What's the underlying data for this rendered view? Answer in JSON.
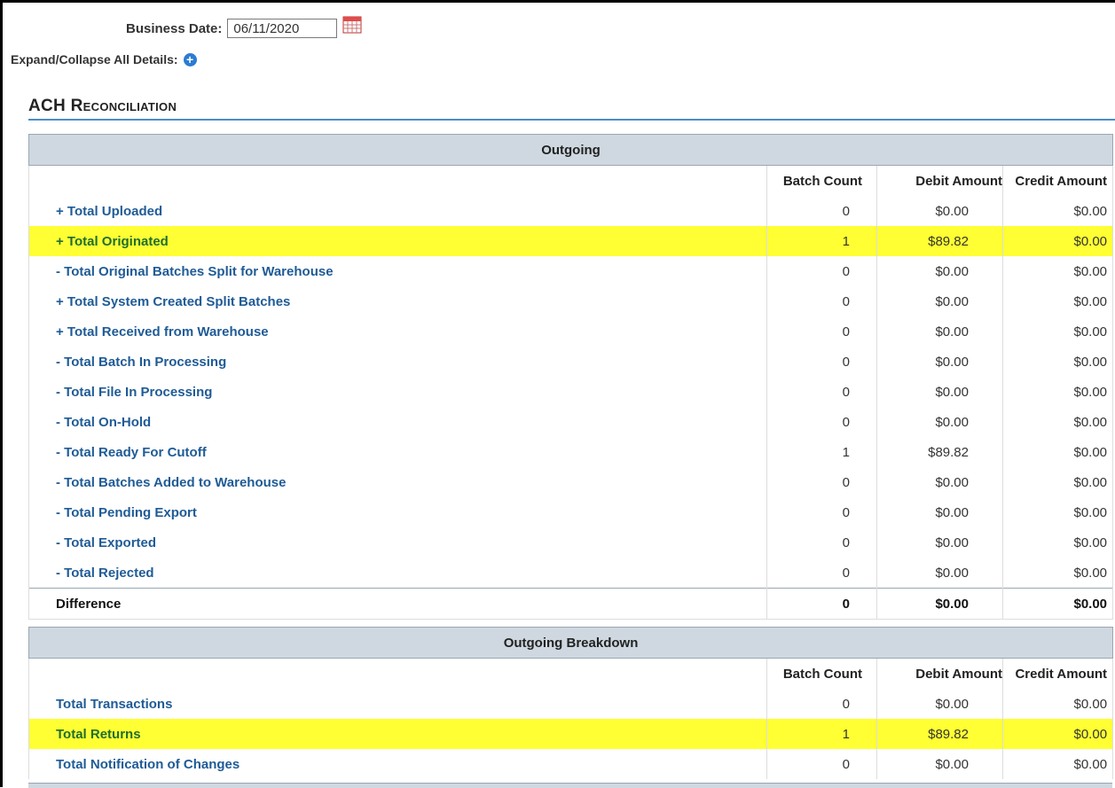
{
  "header": {
    "business_date_label": "Business Date:",
    "business_date_value": "06/11/2020",
    "expand_label": "Expand/Collapse All Details:"
  },
  "section_title": "ACH Reconciliation",
  "outgoing": {
    "title": "Outgoing",
    "columns": [
      "Batch Count",
      "Debit Amount",
      "Credit Amount"
    ],
    "rows": [
      {
        "label": "+ Total Uploaded",
        "batch": "0",
        "debit": "$0.00",
        "credit": "$0.00",
        "highlight": false
      },
      {
        "label": "+ Total Originated",
        "batch": "1",
        "debit": "$89.82",
        "credit": "$0.00",
        "highlight": true
      },
      {
        "label": "- Total Original Batches Split for Warehouse",
        "batch": "0",
        "debit": "$0.00",
        "credit": "$0.00",
        "highlight": false
      },
      {
        "label": "+ Total System Created Split Batches",
        "batch": "0",
        "debit": "$0.00",
        "credit": "$0.00",
        "highlight": false
      },
      {
        "label": "+ Total Received from Warehouse",
        "batch": "0",
        "debit": "$0.00",
        "credit": "$0.00",
        "highlight": false
      },
      {
        "label": "- Total Batch In Processing",
        "batch": "0",
        "debit": "$0.00",
        "credit": "$0.00",
        "highlight": false
      },
      {
        "label": "- Total File In Processing",
        "batch": "0",
        "debit": "$0.00",
        "credit": "$0.00",
        "highlight": false
      },
      {
        "label": "- Total On-Hold",
        "batch": "0",
        "debit": "$0.00",
        "credit": "$0.00",
        "highlight": false
      },
      {
        "label": "- Total Ready For Cutoff",
        "batch": "1",
        "debit": "$89.82",
        "credit": "$0.00",
        "highlight": false
      },
      {
        "label": "- Total Batches Added to Warehouse",
        "batch": "0",
        "debit": "$0.00",
        "credit": "$0.00",
        "highlight": false
      },
      {
        "label": "- Total Pending Export",
        "batch": "0",
        "debit": "$0.00",
        "credit": "$0.00",
        "highlight": false
      },
      {
        "label": "- Total Exported",
        "batch": "0",
        "debit": "$0.00",
        "credit": "$0.00",
        "highlight": false
      },
      {
        "label": "- Total Rejected",
        "batch": "0",
        "debit": "$0.00",
        "credit": "$0.00",
        "highlight": false
      }
    ],
    "difference": {
      "label": "Difference",
      "batch": "0",
      "debit": "$0.00",
      "credit": "$0.00"
    }
  },
  "breakdown": {
    "title": "Outgoing Breakdown",
    "columns": [
      "Batch Count",
      "Debit Amount",
      "Credit Amount"
    ],
    "rows": [
      {
        "label": "Total Transactions",
        "batch": "0",
        "debit": "$0.00",
        "credit": "$0.00",
        "highlight": false
      },
      {
        "label": "Total Returns",
        "batch": "1",
        "debit": "$89.82",
        "credit": "$0.00",
        "highlight": true
      },
      {
        "label": "Total Notification of Changes",
        "batch": "0",
        "debit": "$0.00",
        "credit": "$0.00",
        "highlight": false
      }
    ]
  },
  "colors": {
    "link": "#1f5b96",
    "highlight": "#ffff33",
    "header_bg": "#cfd8e0",
    "accent": "#4a8fc1"
  }
}
